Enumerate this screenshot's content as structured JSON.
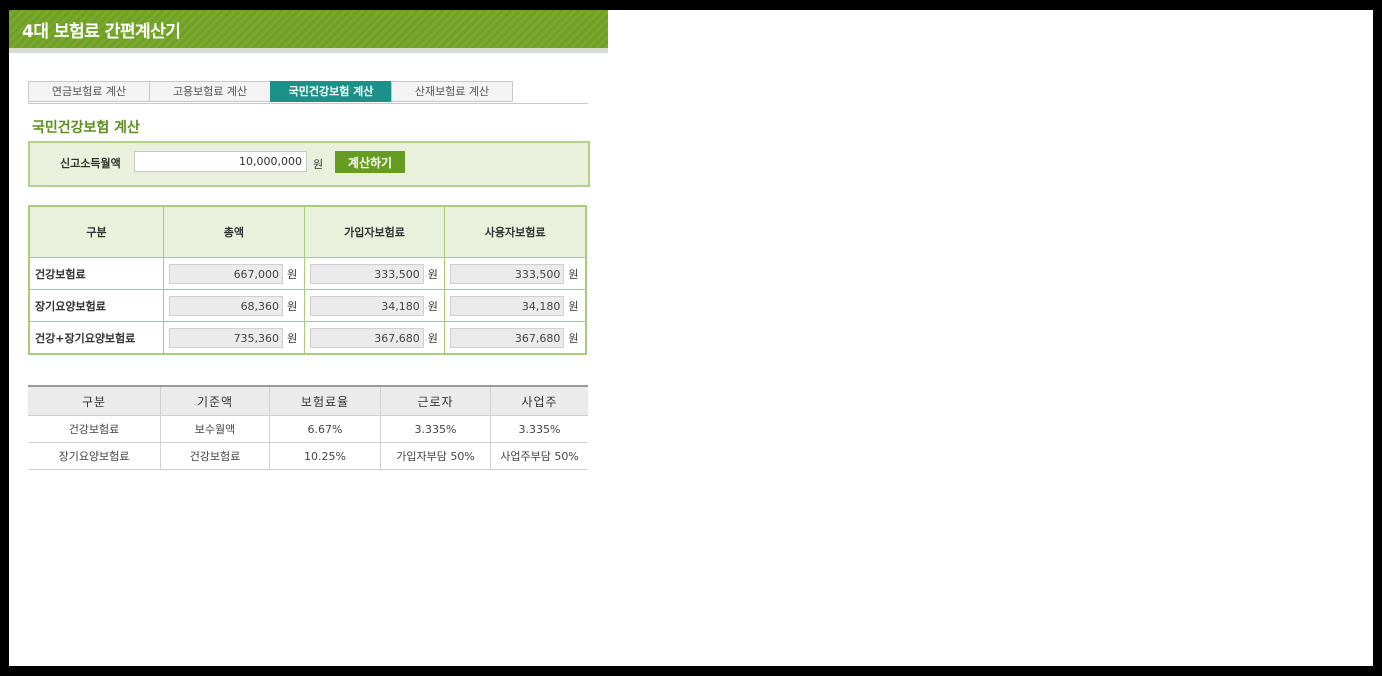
{
  "header": {
    "title": "4대 보험료 간편계산기"
  },
  "tabs": [
    {
      "label": "연금보험료 계산",
      "active": false
    },
    {
      "label": "고용보험료 계산",
      "active": false
    },
    {
      "label": "국민건강보험 계산",
      "active": true
    },
    {
      "label": "산재보험료 계산",
      "active": false
    }
  ],
  "section": {
    "title": "국민건강보험 계산"
  },
  "income": {
    "label": "신고소득월액",
    "value": "10,000,000",
    "unit": "원",
    "button_label": "계산하기"
  },
  "result": {
    "headers": [
      "구분",
      "총액",
      "가입자보험료",
      "사용자보험료"
    ],
    "unit": "원",
    "rows": [
      {
        "label": "건강보험료",
        "values": [
          "667,000",
          "333,500",
          "333,500"
        ]
      },
      {
        "label": "장기요양보험료",
        "values": [
          "68,360",
          "34,180",
          "34,180"
        ]
      },
      {
        "label": "건강+장기요양보험료",
        "values": [
          "735,360",
          "367,680",
          "367,680"
        ]
      }
    ]
  },
  "rates": {
    "headers": [
      "구분",
      "기준액",
      "보험료율",
      "근로자",
      "사업주"
    ],
    "rows": [
      [
        "건강보험료",
        "보수월액",
        "6.67%",
        "3.335%",
        "3.335%"
      ],
      [
        "장기요양보험료",
        "건강보험료",
        "10.25%",
        "가입자부담 50%",
        "사업주부담 50%"
      ]
    ]
  },
  "colors": {
    "header_green": "#6f9f24",
    "tab_active": "#1c9189",
    "title_green": "#5d8f1e",
    "panel_bg": "#e9f1dc",
    "border_green": "#a9cd7a"
  }
}
